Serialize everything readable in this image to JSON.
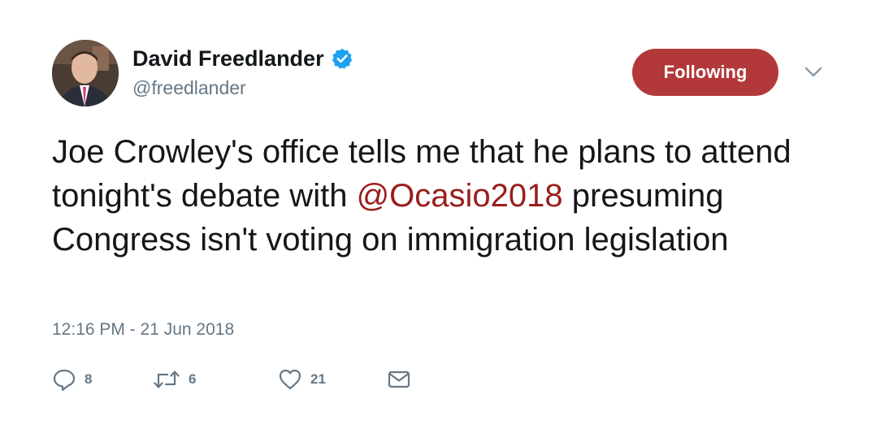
{
  "user": {
    "display_name": "David Freedlander",
    "handle": "@freedlander",
    "verified": true
  },
  "follow_button": {
    "label": "Following"
  },
  "tweet": {
    "text_before": "Joe Crowley's office tells me that he plans to attend tonight's debate with ",
    "mention": "@Ocasio2018",
    "text_after": " presuming Congress isn't voting on immigration legislation",
    "timestamp": "12:16 PM - 21 Jun 2018"
  },
  "actions": {
    "replies": "8",
    "retweets": "6",
    "likes": "21"
  },
  "icons": {
    "verified": "verified-badge-icon",
    "caret": "chevron-down-icon",
    "reply": "reply-icon",
    "retweet": "retweet-icon",
    "like": "heart-icon",
    "message": "envelope-icon"
  },
  "colors": {
    "follow_button": "#b3383a",
    "mention": "#9a1e1e",
    "verified": "#1da1f2",
    "secondary_text": "#657786"
  }
}
